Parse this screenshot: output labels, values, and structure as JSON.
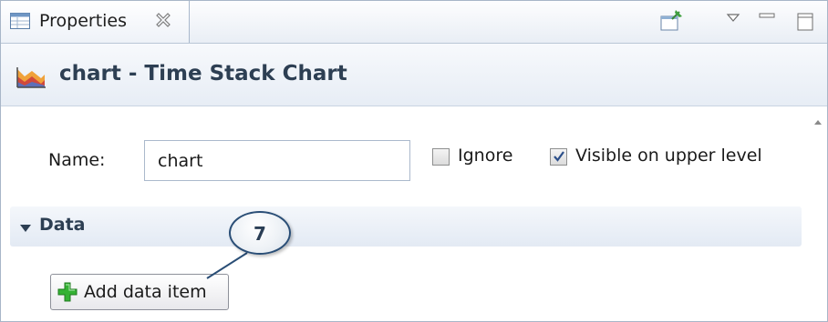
{
  "tab": {
    "label": "Properties"
  },
  "header": {
    "title": "chart - Time Stack Chart"
  },
  "form": {
    "name_label": "Name:",
    "name_value": "chart",
    "ignore": {
      "label": "Ignore",
      "checked": false
    },
    "visible": {
      "label": "Visible on upper level",
      "checked": true
    }
  },
  "section": {
    "title": "Data",
    "expanded": true
  },
  "add_button": {
    "label": "Add data item"
  },
  "callout": {
    "number": "7"
  },
  "colors": {
    "title": "#2d3f53",
    "callout_border": "#2a4e76",
    "add_icon": "#2fa82f"
  },
  "icons": [
    "properties-icon",
    "close-icon",
    "pin-icon",
    "view-menu-icon",
    "minimize-icon",
    "maximize-icon",
    "time-stack-chart-icon",
    "scroll-up-icon",
    "collapse-icon",
    "add-icon"
  ]
}
